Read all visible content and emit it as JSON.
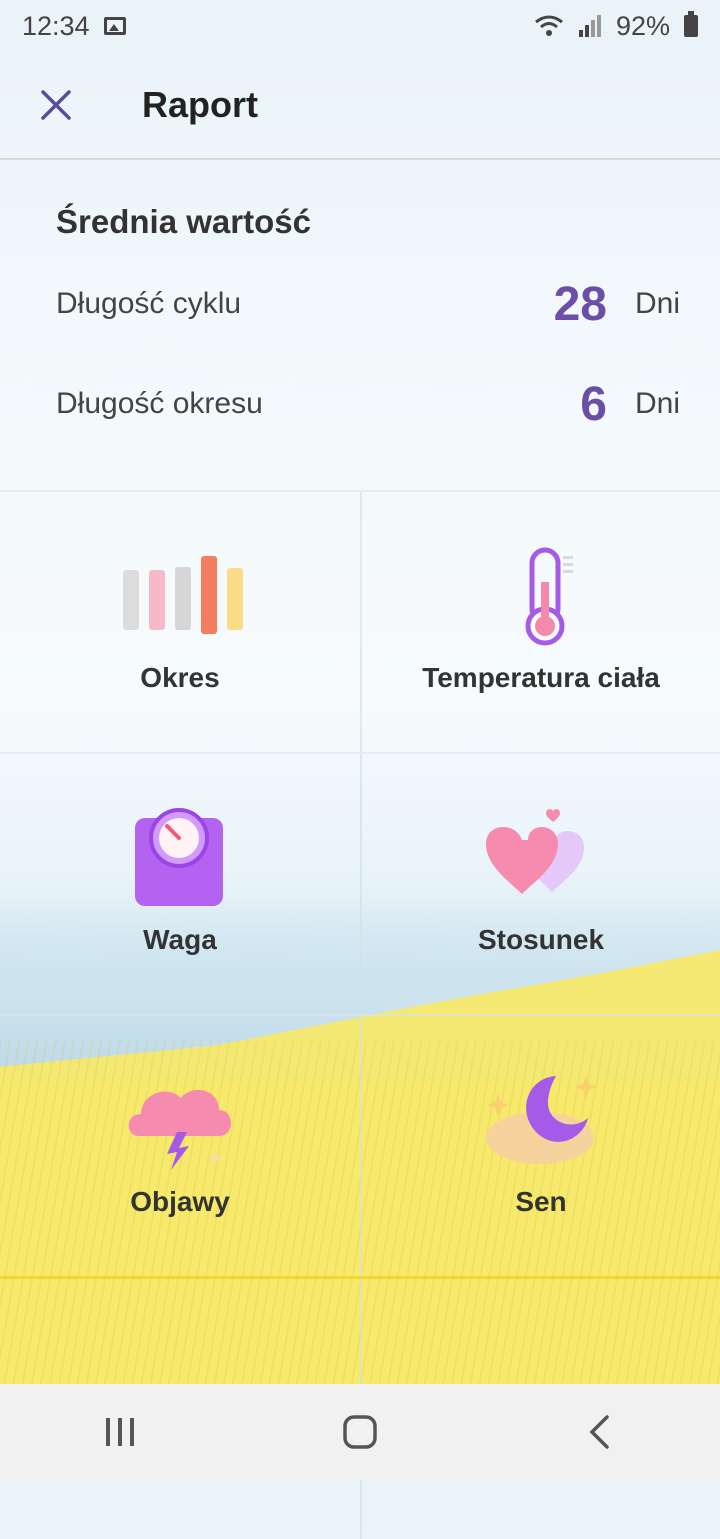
{
  "status_bar": {
    "time": "12:34",
    "battery": "92%"
  },
  "header": {
    "title": "Raport"
  },
  "averages": {
    "title": "Średnia wartość",
    "rows": [
      {
        "label": "Długość cyklu",
        "value": "28",
        "unit": "Dni"
      },
      {
        "label": "Długość okresu",
        "value": "6",
        "unit": "Dni"
      }
    ]
  },
  "tiles": [
    {
      "label": "Okres",
      "icon": "period-bars-icon"
    },
    {
      "label": "Temperatura ciała",
      "icon": "thermometer-icon"
    },
    {
      "label": "Waga",
      "icon": "scale-icon"
    },
    {
      "label": "Stosunek",
      "icon": "hearts-icon"
    },
    {
      "label": "Objawy",
      "icon": "storm-cloud-icon"
    },
    {
      "label": "Sen",
      "icon": "moon-icon"
    }
  ],
  "colors": {
    "accent": "#6c4ea6",
    "purple_icon": "#a55be8",
    "pink_icon": "#f48aab"
  }
}
